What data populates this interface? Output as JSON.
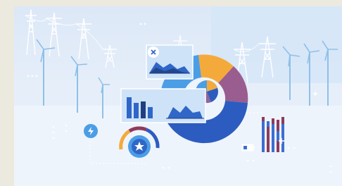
{
  "illustration": {
    "colors": {
      "frame": "#ece9df",
      "sky_top": "#dfeaf8",
      "sky_bottom": "#eef4fc",
      "blob": "#cfe2f6",
      "structure": "#ffffff",
      "turbine": "#9cc8ea",
      "donut_orange": "#f4aa3a",
      "donut_purple": "#9a5d8f",
      "donut_blue_dark": "#2d5cc0",
      "donut_blue_light": "#4b9de6",
      "panel": "#cfe3f8",
      "chart_blue": "#2f66c8",
      "chart_dark": "#1f3f80",
      "stack_red": "#8e3a5e",
      "stack_blue": "#3c6fd0"
    },
    "icons": [
      "close-icon",
      "lightning-icon",
      "star-icon",
      "battery-icon",
      "gauge-icon",
      "pie-chart-icon",
      "bar-chart-icon",
      "area-chart-icon",
      "wind-turbine-icon",
      "power-pylon-icon"
    ]
  }
}
